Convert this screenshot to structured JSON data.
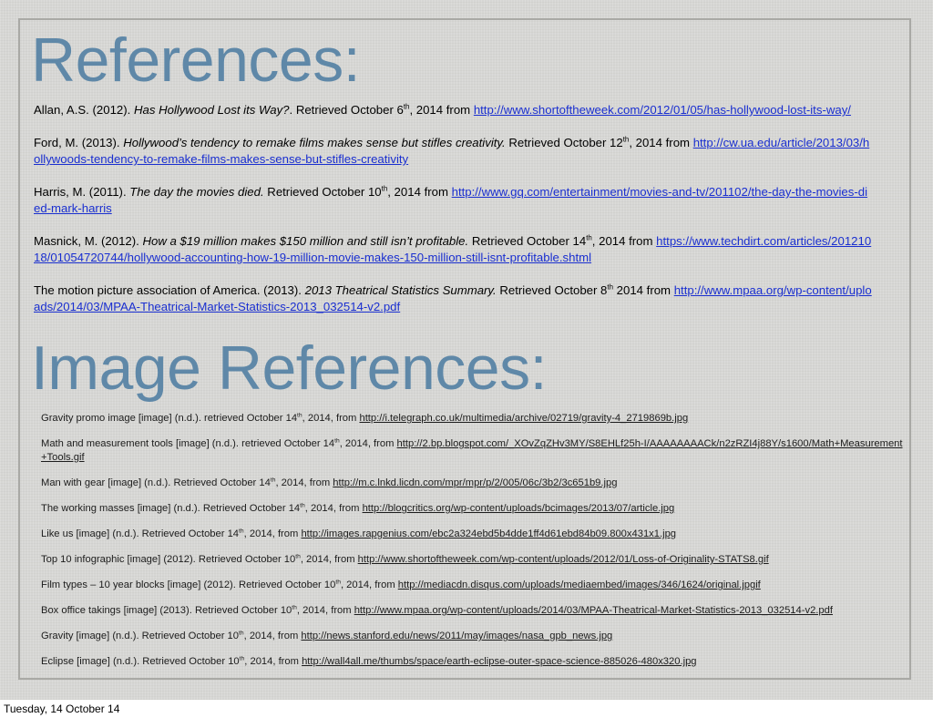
{
  "slide": {
    "title": "References:",
    "image_title": "Image References:",
    "references": [
      {
        "author": "Allan, A.S. (2012). ",
        "title": "Has Hollywood Lost its Way?",
        "retrieved": ". Retrieved October 6",
        "sup": "th",
        "after": ", 2014 from ",
        "url": "http://www.shortoftheweek.com/2012/01/05/has-hollywood-lost-its-way/"
      },
      {
        "author": "Ford, M. (2013). ",
        "title": "Hollywood’s tendency to remake films makes sense but stifles creativity.",
        "retrieved": " Retrieved October 12",
        "sup": "th",
        "after": ", 2014 from ",
        "url": "http://cw.ua.edu/article/2013/03/hollywoods-tendency-to-remake-films-makes-sense-but-stifles-creativity"
      },
      {
        "author": "Harris, M. (2011). ",
        "title": "The day the movies died.",
        "retrieved": " Retrieved October 10",
        "sup": "th",
        "after": ", 2014 from ",
        "url": "http://www.gq.com/entertainment/movies-and-tv/201102/the-day-the-movies-died-mark-harris"
      },
      {
        "author": "Masnick, M. (2012). ",
        "title": "How a $19 million makes $150 million and still isn’t profitable.",
        "retrieved": " Retrieved October 14",
        "sup": "th",
        "after": ", 2014 from ",
        "url": "https://www.techdirt.com/articles/20121018/01054720744/hollywood-accounting-how-19-million-movie-makes-150-million-still-isnt-profitable.shtml"
      },
      {
        "author": "The motion picture association of America. (2013). ",
        "title": "2013 Theatrical Statistics Summary.",
        "retrieved": " Retrieved October 8",
        "sup": "th",
        "after": " 2014 from ",
        "url": "http://www.mpaa.org/wp-content/uploads/2014/03/MPAA-Theatrical-Market-Statistics-2013_032514-v2.pdf"
      }
    ],
    "image_references": [
      {
        "text": "Gravity promo image [image] (n.d.). retrieved October 14",
        "sup": "th",
        "after": ", 2014, from ",
        "url": "http://i.telegraph.co.uk/multimedia/archive/02719/gravity-4_2719869b.jpg"
      },
      {
        "text": "Math and measurement tools [image] (n.d.). retrieved October 14",
        "sup": "th",
        "after": ", 2014, from ",
        "url": "http://2.bp.blogspot.com/_XOvZqZHv3MY/S8EHLf25h-I/AAAAAAAACk/n2zRZI4j88Y/s1600/Math+Measurement+Tools.gif"
      },
      {
        "text": "Man with gear [image] (n.d.). Retrieved October 14",
        "sup": "th",
        "after": ", 2014, from ",
        "url": "http://m.c.lnkd.licdn.com/mpr/mpr/p/2/005/06c/3b2/3c651b9.jpg"
      },
      {
        "text": "The working masses [image] (n.d.). Retrieved October 14",
        "sup": "th",
        "after": ", 2014, from ",
        "url": "http://blogcritics.org/wp-content/uploads/bcimages/2013/07/article.jpg"
      },
      {
        "text": "Like us [image] (n.d.). Retrieved October 14",
        "sup": "th",
        "after": ", 2014, from ",
        "url": "http://images.rapgenius.com/ebc2a324ebd5b4dde1ff4d61ebd84b09.800x431x1.jpg"
      },
      {
        "text": "Top 10 infographic [image] (2012). Retrieved October 10",
        "sup": "th",
        "after": ", 2014, from ",
        "url": "http://www.shortoftheweek.com/wp-content/uploads/2012/01/Loss-of-Originality-STATS8.gif"
      },
      {
        "text": "Film types – 10 year blocks [image] (2012). Retrieved October 10",
        "sup": "th",
        "after": ", 2014, from ",
        "url": "http://mediacdn.disqus.com/uploads/mediaembed/images/346/1624/original.jpgif"
      },
      {
        "text": "Box office takings [image] (2013). Retrieved October 10",
        "sup": "th",
        "after": ", 2014, from ",
        "url": "http://www.mpaa.org/wp-content/uploads/2014/03/MPAA-Theatrical-Market-Statistics-2013_032514-v2.pdf"
      },
      {
        "text": "Gravity [image] (n.d.). Retrieved October 10",
        "sup": "th",
        "after": ", 2014, from ",
        "url": "http://news.stanford.edu/news/2011/may/images/nasa_gpb_news.jpg"
      },
      {
        "text": "Eclipse [image] (n.d.). Retrieved October 10",
        "sup": "th",
        "after": ", 2014, from ",
        "url": "http://wall4all.me/thumbs/space/earth-eclipse-outer-space-science-885026-480x320.jpg"
      }
    ]
  },
  "footer": {
    "date": "Tuesday, 14 October 14"
  },
  "colors": {
    "heading": "#5f88a8",
    "link": "#1a2fd0",
    "background": "#d9d9d6"
  }
}
